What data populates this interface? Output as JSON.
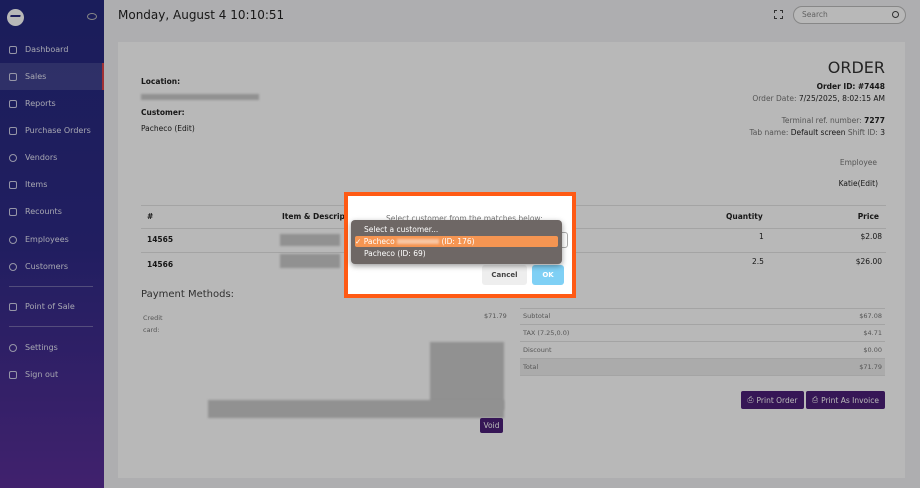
{
  "sidebar": {
    "items": [
      {
        "label": "Dashboard",
        "icon": "home-icon"
      },
      {
        "label": "Sales",
        "icon": "bar-chart-icon",
        "active": true
      },
      {
        "label": "Reports",
        "icon": "bar-chart-icon"
      },
      {
        "label": "Purchase Orders",
        "icon": "bar-chart-icon"
      },
      {
        "label": "Vendors",
        "icon": "globe-icon"
      },
      {
        "label": "Items",
        "icon": "box-icon"
      },
      {
        "label": "Recounts",
        "icon": "box-icon"
      },
      {
        "label": "Employees",
        "icon": "users-icon"
      },
      {
        "label": "Customers",
        "icon": "users-icon"
      },
      {
        "label": "Point of Sale",
        "icon": "cart-icon"
      },
      {
        "label": "Settings",
        "icon": "gear-icon"
      },
      {
        "label": "Sign out",
        "icon": "sign-out-icon"
      }
    ]
  },
  "header": {
    "datetime": "Monday, August 4 10:10:51",
    "search_placeholder": "Search"
  },
  "order": {
    "title": "ORDER",
    "location_label": "Location:",
    "customer_label": "Customer:",
    "customer_value": "Pacheco (Edit)",
    "order_id_label": "Order ID:",
    "order_id": "#7448",
    "order_date_label": "Order Date:",
    "order_date": "7/25/2025, 8:02:15 AM",
    "terminal_label": "Terminal ref. number:",
    "terminal": "7277",
    "tab_label": "Tab name:",
    "tab": "Default screen",
    "shift_label": "Shift ID:",
    "shift": "3",
    "employee_label": "Employee",
    "employee": "Katie(Edit)"
  },
  "table": {
    "headers": [
      "#",
      "Item & Description",
      "Quantity",
      "Price"
    ],
    "rows": [
      {
        "id": "14565",
        "qty": "1",
        "price": "$2.08"
      },
      {
        "id": "14566",
        "qty": "2.5",
        "price": "$26.00"
      }
    ]
  },
  "payments": {
    "title": "Payment Methods:",
    "method": "Credit card:",
    "amount": "$71.79",
    "void": "Void"
  },
  "totals": [
    {
      "label": "Subtotal",
      "value": "$67.08"
    },
    {
      "label": "TAX (7.25,0.0)",
      "value": "$4.71"
    },
    {
      "label": "Discount",
      "value": "$0.00"
    },
    {
      "label": "Total",
      "value": "$71.79"
    }
  ],
  "buttons": {
    "print_order": "Print Order",
    "print_invoice": "Print As Invoice"
  },
  "modal": {
    "prompt": "Select customer from the matches below:",
    "options": [
      "Select a customer...",
      "Pacheco (ID: 176)",
      "Pacheco (ID: 69)"
    ],
    "selected_prefix": "Pacheco",
    "selected_suffix": "(ID: 176)",
    "check": "✓",
    "cancel": "Cancel",
    "ok": "OK"
  },
  "colors": {
    "accent": "#4b1f78",
    "highlight": "#ff5a14",
    "selected": "#f59552",
    "ok": "#7fd0f5"
  }
}
